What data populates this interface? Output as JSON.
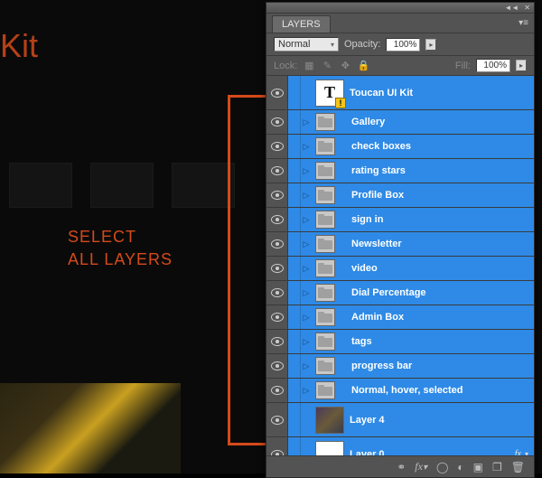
{
  "bg": {
    "title_fragment": "I Kit",
    "annotation_l1": "SELECT",
    "annotation_l2": "ALL LAYERS"
  },
  "panel": {
    "tab": "LAYERS",
    "blend_mode": "Normal",
    "opacity_label": "Opacity:",
    "opacity_value": "100%",
    "lock_label": "Lock:",
    "fill_label": "Fill:",
    "fill_value": "100%"
  },
  "layers": [
    {
      "name": "Toucan UI Kit",
      "type": "text",
      "expand": false,
      "tall": true
    },
    {
      "name": "Gallery",
      "type": "folder",
      "expand": true
    },
    {
      "name": "check boxes",
      "type": "folder",
      "expand": true
    },
    {
      "name": "rating stars",
      "type": "folder",
      "expand": true
    },
    {
      "name": "Profile Box",
      "type": "folder",
      "expand": true
    },
    {
      "name": "sign in",
      "type": "folder",
      "expand": true
    },
    {
      "name": "Newsletter",
      "type": "folder",
      "expand": true
    },
    {
      "name": "video",
      "type": "folder",
      "expand": true
    },
    {
      "name": "Dial Percentage",
      "type": "folder",
      "expand": true
    },
    {
      "name": "Admin Box",
      "type": "folder",
      "expand": true
    },
    {
      "name": "tags",
      "type": "folder",
      "expand": true
    },
    {
      "name": "progress bar",
      "type": "folder",
      "expand": true
    },
    {
      "name": "Normal, hover, selected",
      "type": "folder",
      "expand": true
    },
    {
      "name": "Layer 4",
      "type": "img4",
      "expand": false,
      "tall": true
    },
    {
      "name": "Layer 0",
      "type": "white",
      "expand": false,
      "tall": true,
      "fx": true
    }
  ]
}
